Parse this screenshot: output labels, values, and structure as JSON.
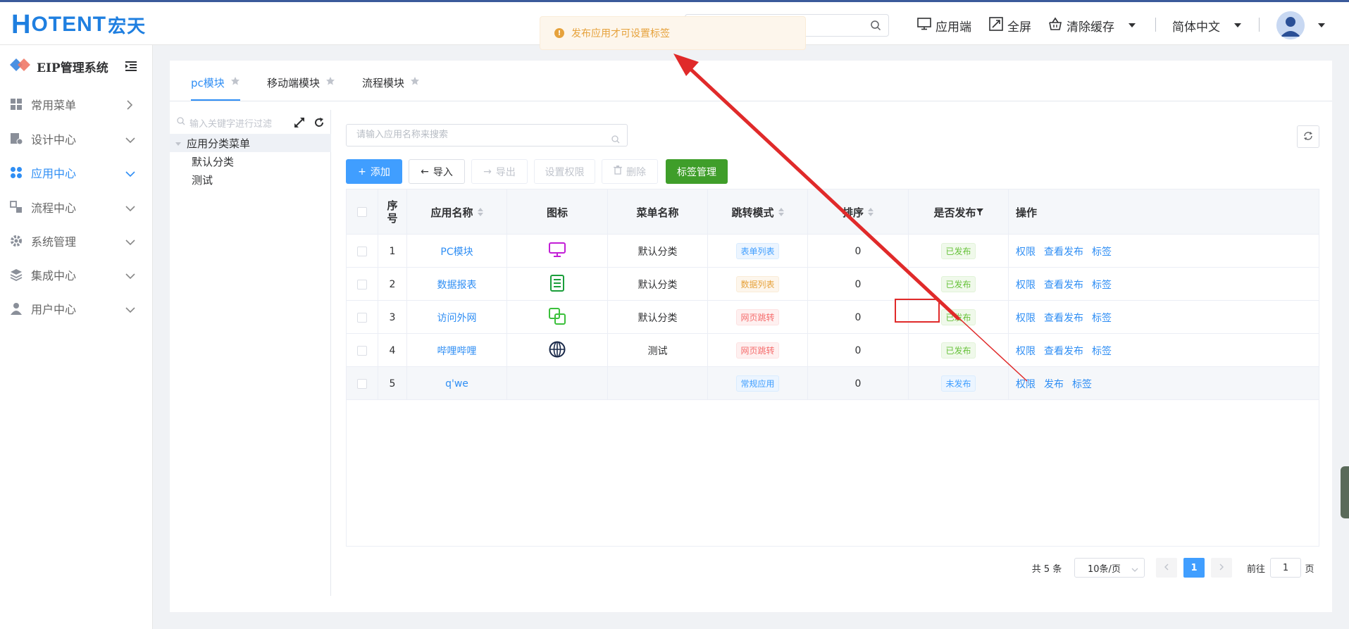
{
  "header": {
    "logo_text_big": "H",
    "logo_text": "OTENT",
    "logo_cn": "宏天",
    "app_client_label": "应用端",
    "fullscreen_label": "全屏",
    "clear_cache_label": "清除缓存",
    "language_label": "简体中文"
  },
  "sidebar": {
    "title": "EIP管理系统",
    "items": [
      {
        "label": "常用菜单",
        "icon": "grid-icon"
      },
      {
        "label": "设计中心",
        "icon": "design-icon"
      },
      {
        "label": "应用中心",
        "icon": "apps-icon"
      },
      {
        "label": "流程中心",
        "icon": "flow-icon"
      },
      {
        "label": "系统管理",
        "icon": "gear-icon"
      },
      {
        "label": "集成中心",
        "icon": "layers-icon"
      },
      {
        "label": "用户中心",
        "icon": "user-icon"
      }
    ]
  },
  "tabs": [
    "pc模块",
    "移动端模块",
    "流程模块"
  ],
  "tree": {
    "placeholder": "输入关键字进行过滤",
    "root": "应用分类菜单",
    "children": [
      "默认分类",
      "测试"
    ]
  },
  "content": {
    "search_placeholder": "请输入应用名称来搜索",
    "buttons": {
      "add": "添加",
      "import": "导入",
      "export": "导出",
      "permission": "设置权限",
      "delete": "删除",
      "tag_manage": "标签管理"
    },
    "columns": [
      "序号",
      "应用名称",
      "图标",
      "菜单名称",
      "跳转模式",
      "排序",
      "是否发布",
      "操作"
    ],
    "rows": [
      {
        "no": "1",
        "name": "PC模块",
        "menu": "默认分类",
        "mode": "表单列表",
        "sort": "0",
        "published": "已发布",
        "ops": [
          "权限",
          "查看发布",
          "标签"
        ]
      },
      {
        "no": "2",
        "name": "数据报表",
        "menu": "默认分类",
        "mode": "数据列表",
        "sort": "0",
        "published": "已发布",
        "ops": [
          "权限",
          "查看发布",
          "标签"
        ]
      },
      {
        "no": "3",
        "name": "访问外网",
        "menu": "默认分类",
        "mode": "网页跳转",
        "sort": "0",
        "published": "已发布",
        "ops": [
          "权限",
          "查看发布",
          "标签"
        ]
      },
      {
        "no": "4",
        "name": "哔哩哔哩",
        "menu": "测试",
        "mode": "网页跳转",
        "sort": "0",
        "published": "已发布",
        "ops": [
          "权限",
          "查看发布",
          "标签"
        ]
      },
      {
        "no": "5",
        "name": "q'we",
        "menu": "",
        "mode": "常规应用",
        "sort": "0",
        "published": "未发布",
        "ops": [
          "权限",
          "发布",
          "标签"
        ]
      }
    ],
    "pagination": {
      "total": "共 5 条",
      "page_size": "10条/页",
      "current": "1",
      "goto_label": "前往",
      "goto_value": "1",
      "page_suffix": "页"
    }
  },
  "toast": {
    "message": "发布应用才可设置标签"
  },
  "colors": {
    "accent": "#2f8ef4",
    "green_button": "#3f9e2a",
    "warning": "#e6a23c",
    "annotation": "#e02a2a"
  }
}
